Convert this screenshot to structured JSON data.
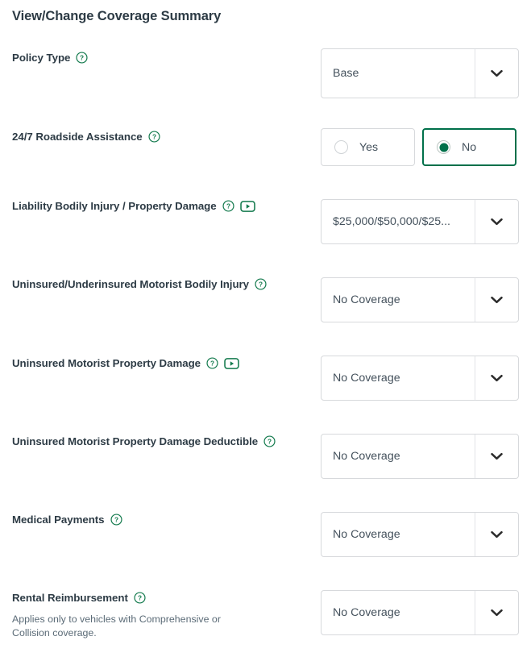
{
  "page": {
    "title": "View/Change Coverage Summary",
    "accent_color": "#00704a",
    "text_color": "#2d3b45",
    "border_color": "#d7d9dc",
    "background": "#ffffff"
  },
  "rows": [
    {
      "label": "Policy Type",
      "has_help_icon": true,
      "has_video_icon": false,
      "control": "select",
      "value": "Base",
      "helper": ""
    },
    {
      "label": "24/7 Roadside Assistance",
      "has_help_icon": true,
      "has_video_icon": false,
      "control": "radio",
      "options": [
        "Yes",
        "No"
      ],
      "selected": "No",
      "helper": ""
    },
    {
      "label": "Liability Bodily Injury / Property Damage",
      "has_help_icon": true,
      "has_video_icon": true,
      "control": "select",
      "value": "$25,000/$50,000/$25...",
      "helper": ""
    },
    {
      "label": "Uninsured/Underinsured Motorist Bodily Injury",
      "has_help_icon": true,
      "has_video_icon": false,
      "control": "select",
      "value": "No Coverage",
      "helper": ""
    },
    {
      "label": "Uninsured Motorist Property Damage",
      "has_help_icon": true,
      "has_video_icon": true,
      "control": "select",
      "value": "No Coverage",
      "helper": ""
    },
    {
      "label": "Uninsured Motorist Property Damage Deductible",
      "has_help_icon": true,
      "has_video_icon": false,
      "control": "select",
      "value": "No Coverage",
      "helper": ""
    },
    {
      "label": "Medical Payments",
      "has_help_icon": true,
      "has_video_icon": false,
      "control": "select",
      "value": "No Coverage",
      "helper": ""
    },
    {
      "label": "Rental Reimbursement",
      "has_help_icon": true,
      "has_video_icon": false,
      "control": "select",
      "value": "No Coverage",
      "helper": "Applies only to vehicles with Comprehensive or Collision coverage."
    }
  ],
  "icons": {
    "help": "help-circle-icon",
    "video": "video-play-icon",
    "chevron": "chevron-down-icon"
  }
}
